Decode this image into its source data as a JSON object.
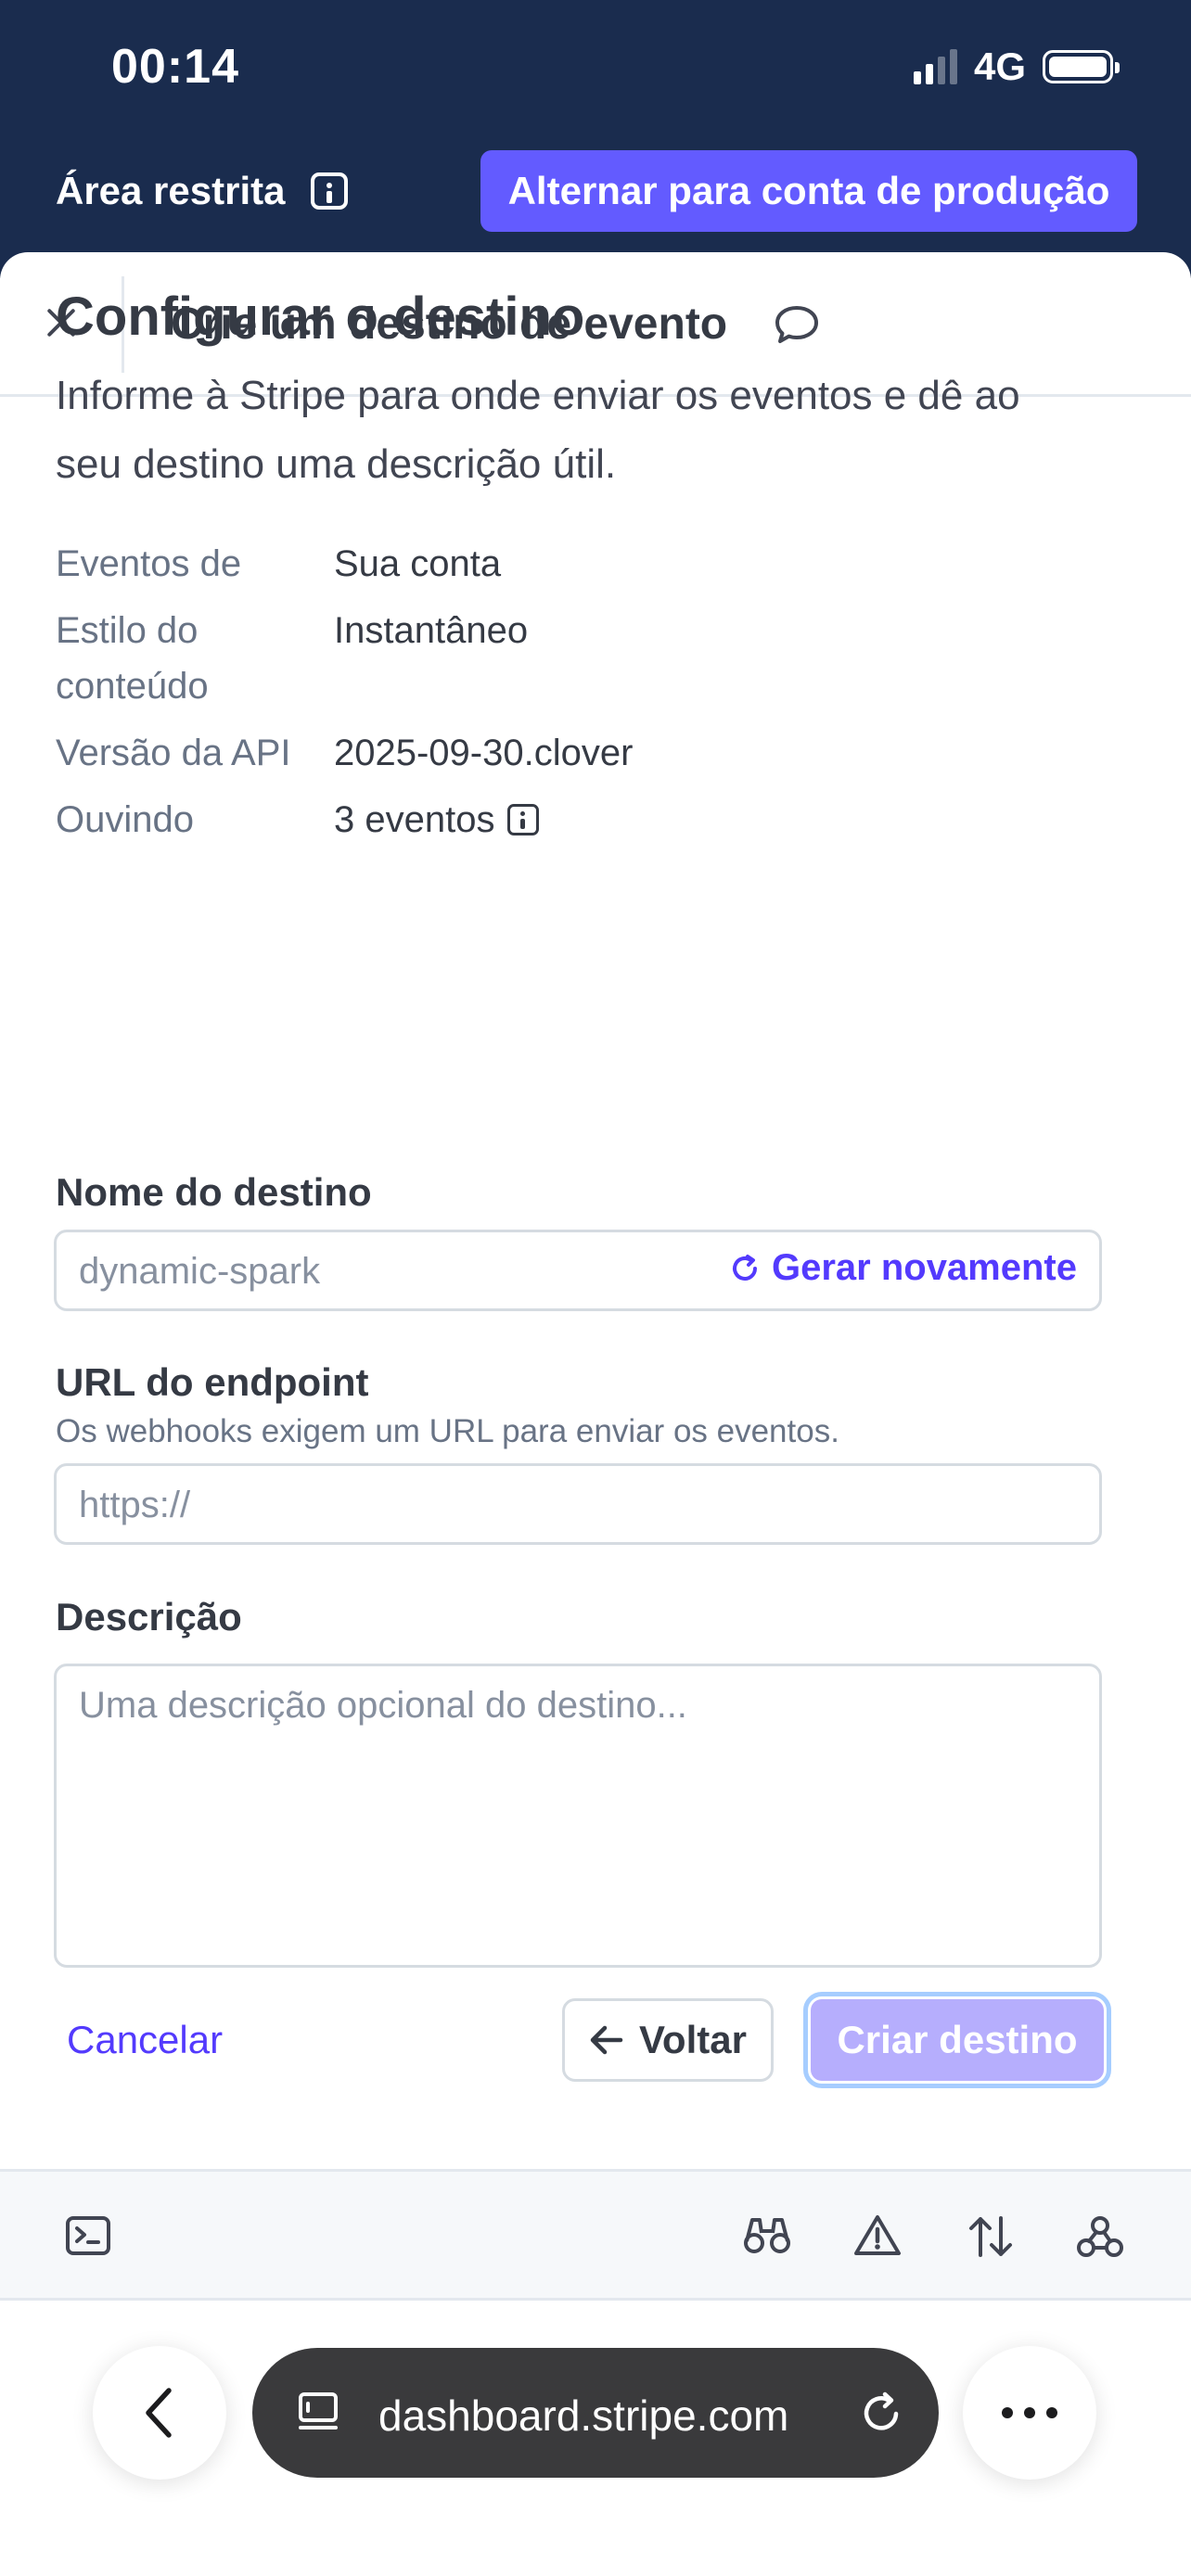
{
  "status_bar": {
    "time": "00:14",
    "network": "4G"
  },
  "environment": {
    "label": "Área restrita",
    "switch_button": "Alternar para conta de produção"
  },
  "dialog": {
    "title": "Crie um destino de evento"
  },
  "section": {
    "heading": "Configurar o destino",
    "description": "Informe à Stripe para onde enviar os eventos e dê ao seu destino uma descrição útil."
  },
  "properties": [
    {
      "key": "Eventos de",
      "value": "Sua conta"
    },
    {
      "key": "Estilo do conteúdo",
      "value": "Instantâneo"
    },
    {
      "key": "Versão da API",
      "value": "2025-09-30.clover"
    },
    {
      "key": "Ouvindo",
      "value": "3 eventos"
    }
  ],
  "form": {
    "name_label": "Nome do destino",
    "name_placeholder": "dynamic-spark",
    "regenerate_label": "Gerar novamente",
    "url_label": "URL do endpoint",
    "url_hint": "Os webhooks exigem um URL para enviar os eventos.",
    "url_placeholder": "https://",
    "description_label": "Descrição",
    "description_placeholder": "Uma descrição opcional do destino..."
  },
  "actions": {
    "cancel": "Cancelar",
    "back": "Voltar",
    "create": "Criar destino"
  },
  "devtools": {
    "icons": [
      "terminal-icon",
      "binoculars-icon",
      "warning-icon",
      "sort-arrows-icon",
      "webhook-icon"
    ]
  },
  "browser": {
    "url": "dashboard.stripe.com"
  },
  "colors": {
    "header_bg": "#1a2c4e",
    "brand": "#635bff",
    "link": "#533afd",
    "disabled_primary": "#b6aefd"
  }
}
